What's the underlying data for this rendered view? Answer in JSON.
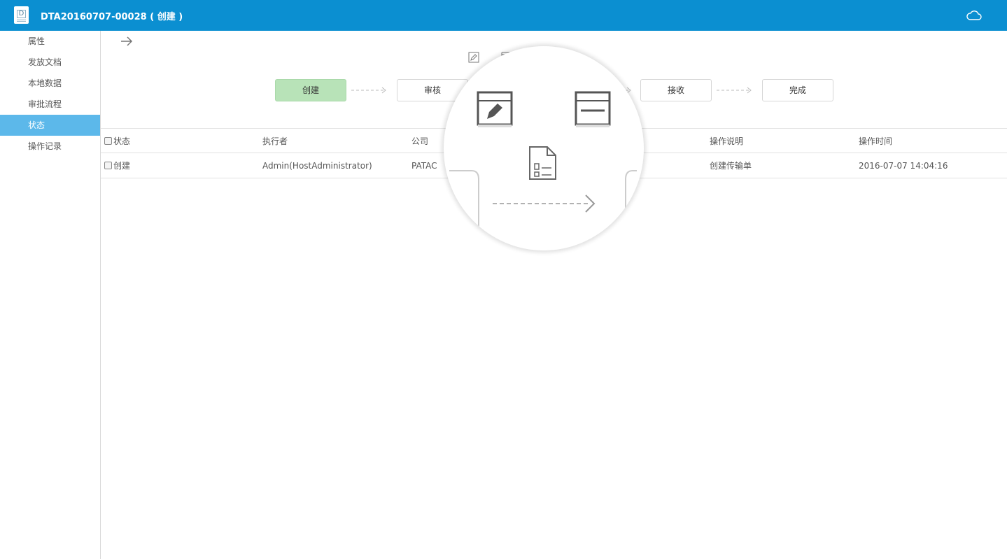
{
  "header": {
    "doc_icon_letter": "D",
    "title": "DTA20160707-00028 ( 创建 )",
    "cloud_icon": "cloud-icon"
  },
  "sidebar": {
    "items": [
      {
        "label": "属性",
        "active": false
      },
      {
        "label": "发放文档",
        "active": false
      },
      {
        "label": "本地数据",
        "active": false
      },
      {
        "label": "审批流程",
        "active": false
      },
      {
        "label": "状态",
        "active": true
      },
      {
        "label": "操作记录",
        "active": false
      }
    ]
  },
  "workflow": {
    "steps": [
      {
        "label": "创建",
        "current": true
      },
      {
        "label": "审核",
        "current": false
      },
      {
        "label": "接收",
        "current": false
      },
      {
        "label": "完成",
        "current": false
      }
    ]
  },
  "table": {
    "headers": [
      "状态",
      "执行者",
      "公司",
      "操作说明",
      "操作时间"
    ],
    "rows": [
      [
        "创建",
        "Admin(HostAdministrator)",
        "PATAC",
        "创建传输单",
        "2016-07-07 14:04:16"
      ]
    ]
  },
  "colors": {
    "header_bg": "#0b8fd1",
    "sidebar_active": "#5cb8ea",
    "step_current": "#b8e3b8"
  }
}
